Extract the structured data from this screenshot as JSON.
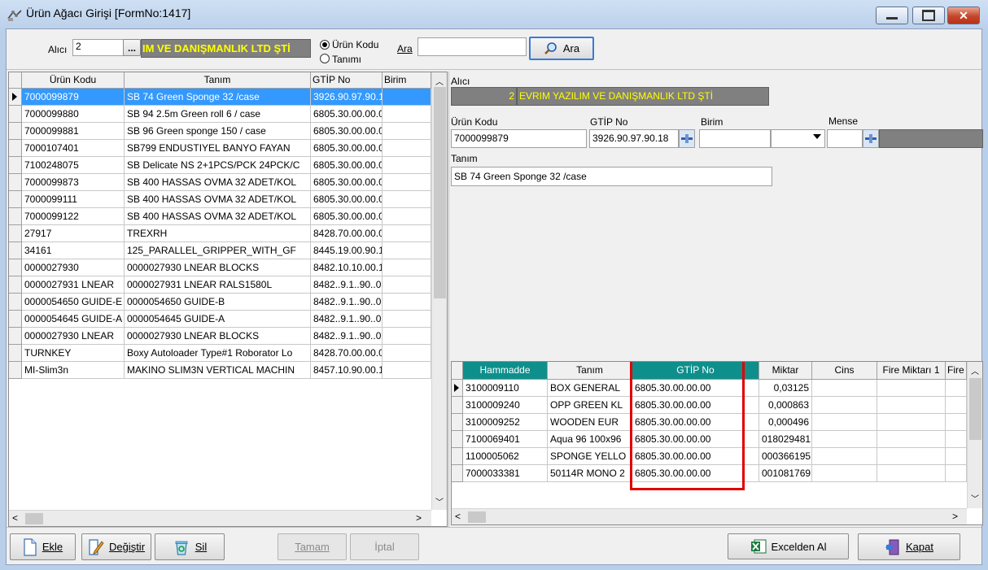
{
  "window": {
    "title": "Ürün Ağacı Girişi [FormNo:1417]",
    "minimize": "–",
    "maximize": "□",
    "close": "✕"
  },
  "top": {
    "alici_label": "Alıcı",
    "alici_value": "2",
    "ellipsis": "...",
    "company": "IM VE DANIŞMANLIK LTD ŞTİ",
    "radio_urun_kodu": "Ürün Kodu",
    "radio_tanimi": "Tanımı",
    "ara_label": "Ara",
    "ara_value": "",
    "ara_button": "Ara"
  },
  "left_grid": {
    "columns": [
      "Ürün Kodu",
      "Tanım",
      "GTİP No",
      "Birim"
    ],
    "rows": [
      [
        "7000099879",
        "SB 74 Green Sponge 32 /case",
        "3926.90.97.90.1",
        ""
      ],
      [
        "7000099880",
        "SB 94 2.5m Green roll 6 / case",
        "6805.30.00.00.0",
        ""
      ],
      [
        "7000099881",
        "SB 96 Green sponge 150 / case",
        "6805.30.00.00.0",
        ""
      ],
      [
        "7000107401",
        "SB799 ENDUSTIYEL BANYO FAYAN",
        "6805.30.00.00.0",
        ""
      ],
      [
        "7100248075",
        "SB Delicate NS 2+1PCS/PCK 24PCK/C",
        "6805.30.00.00.0",
        ""
      ],
      [
        "7000099873",
        "SB 400 HASSAS OVMA 32 ADET/KOL",
        "6805.30.00.00.0",
        ""
      ],
      [
        "7000099111",
        "SB 400 HASSAS OVMA 32 ADET/KOL",
        "6805.30.00.00.0",
        ""
      ],
      [
        "7000099122",
        "SB 400 HASSAS OVMA 32 ADET/KOL",
        "6805.30.00.00.0",
        ""
      ],
      [
        "27917",
        "TREXRH",
        "8428.70.00.00.0",
        ""
      ],
      [
        "34161",
        "125_PARALLEL_GRIPPER_WITH_GF",
        "8445.19.00.90.1",
        ""
      ],
      [
        "0000027930",
        "0000027930 LNEAR BLOCKS",
        "8482.10.10.00.1",
        ""
      ],
      [
        "0000027931 LNEAR",
        "0000027931 LNEAR RALS1580L",
        "8482..9.1..90..0",
        ""
      ],
      [
        "0000054650 GUIDE-E",
        "0000054650 GUIDE-B",
        "8482..9.1..90..0",
        ""
      ],
      [
        "0000054645 GUIDE-A",
        "0000054645 GUIDE-A",
        "8482..9.1..90..0",
        ""
      ],
      [
        "0000027930 LNEAR",
        "0000027930 LNEAR BLOCKS",
        "8482..9.1..90..0",
        ""
      ],
      [
        "TURNKEY",
        "Boxy Autoloader Type#1 Roborator Lo",
        "8428.70.00.00.0",
        ""
      ],
      [
        "MI-Slim3n",
        "MAKINO SLIM3N VERTICAL MACHIN",
        "8457.10.90.00.1",
        ""
      ]
    ]
  },
  "detail": {
    "alici_label": "Alıcı",
    "alici_no": "2",
    "alici_name": "EVRIM YAZILIM VE DANIŞMANLIK LTD ŞTİ",
    "urun_kodu_label": "Ürün Kodu",
    "urun_kodu": "7000099879",
    "gtip_label": "GTİP No",
    "gtip": "3926.90.97.90.18",
    "birim_label": "Birim",
    "birim": "",
    "mense_label": "Mense",
    "mense": "",
    "tanim_label": "Tanım",
    "tanim": "SB 74 Green Sponge 32 /case"
  },
  "right_grid": {
    "columns": [
      "Hammadde",
      "Tanım",
      "GTİP No",
      "Miktar",
      "Cins",
      "Fire Miktarı 1",
      "Fire"
    ],
    "rows": [
      [
        "3100009110",
        "BOX GENERAL",
        "6805.30.00.00.00",
        "0,03125",
        "",
        ""
      ],
      [
        "3100009240",
        "OPP GREEN KL",
        "6805.30.00.00.00",
        "0,000863",
        "",
        ""
      ],
      [
        "3100009252",
        "WOODEN EUR",
        "6805.30.00.00.00",
        "0,000496",
        "",
        ""
      ],
      [
        "7100069401",
        "Aqua 96 100x96",
        "6805.30.00.00.00",
        "018029481",
        "",
        ""
      ],
      [
        "1100005062",
        "SPONGE YELLO",
        "6805.30.00.00.00",
        "000366195",
        "",
        ""
      ],
      [
        "7000033381",
        "50114R MONO 2",
        "6805.30.00.00.00",
        "001081769",
        "",
        ""
      ]
    ]
  },
  "buttons": {
    "ekle": "Ekle",
    "degistir": "Değiştir",
    "sil": "Sil",
    "tamam": "Tamam",
    "iptal": "İptal",
    "excelden_al": "Excelden Al",
    "kapat": "Kapat"
  },
  "colors": {
    "selection": "#3399ff",
    "highlight_box": "#e00000",
    "teal_header": "#0f8f8c",
    "company_text": "#ffff00"
  }
}
